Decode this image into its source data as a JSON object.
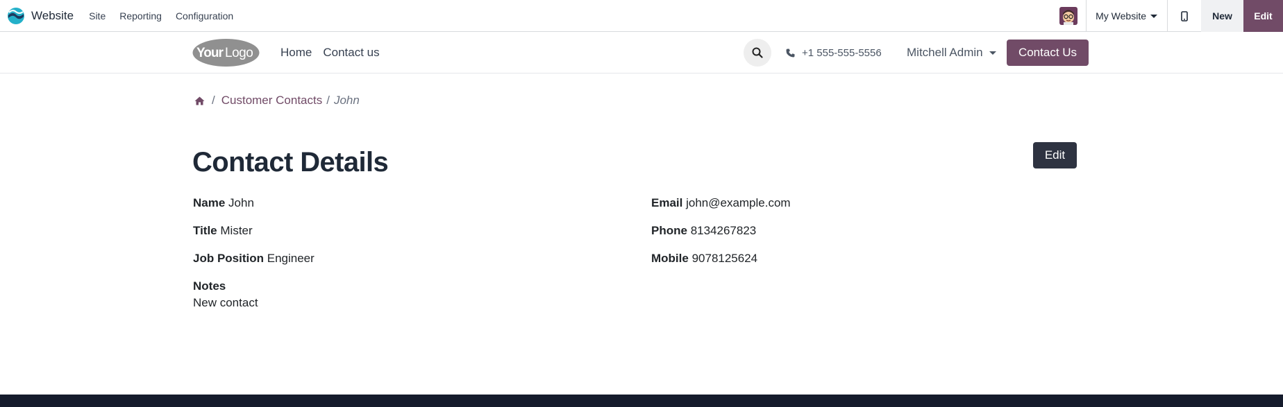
{
  "admin_bar": {
    "app_name": "Website",
    "menu": [
      "Site",
      "Reporting",
      "Configuration"
    ],
    "site_switcher": "My Website",
    "new_label": "New",
    "edit_label": "Edit",
    "accent_color": "#714b67"
  },
  "site_header": {
    "logo_text": "YourLogo",
    "nav": [
      "Home",
      "Contact us"
    ],
    "phone": "+1 555-555-5556",
    "user_name": "Mitchell Admin",
    "cta_label": "Contact Us"
  },
  "breadcrumb": {
    "home_icon": "home-icon",
    "separator": "/",
    "parent": "Customer Contacts",
    "current": "John"
  },
  "page": {
    "title": "Contact Details",
    "edit_label": "Edit"
  },
  "fields": {
    "name": {
      "label": "Name",
      "value": "John"
    },
    "title": {
      "label": "Title",
      "value": "Mister"
    },
    "job_position": {
      "label": "Job Position",
      "value": "Engineer"
    },
    "email": {
      "label": "Email",
      "value": "john@example.com"
    },
    "phone": {
      "label": "Phone",
      "value": "8134267823"
    },
    "mobile": {
      "label": "Mobile",
      "value": "9078125624"
    },
    "notes": {
      "label": "Notes",
      "value": "New contact"
    }
  }
}
